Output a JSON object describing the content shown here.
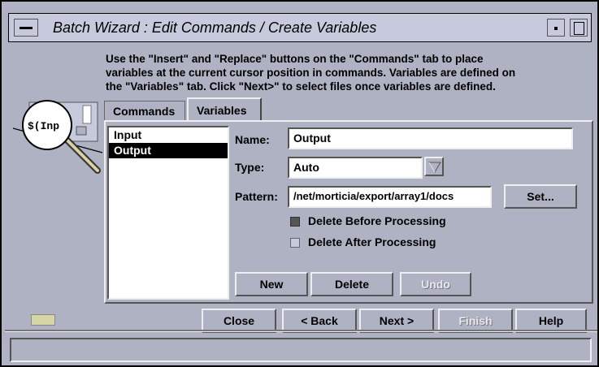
{
  "window": {
    "title": "Batch Wizard : Edit Commands / Create Variables"
  },
  "instructions": {
    "line1": "Use the \"Insert\" and \"Replace\" buttons on the \"Commands\" tab to place",
    "line2": "variables at the current cursor position in commands. Variables are defined on",
    "line3": "the \"Variables\" tab. Click \"Next>\" to select files once variables are defined."
  },
  "icon": {
    "magnifier_text": "$(Inp"
  },
  "tabs": {
    "commands": "Commands",
    "variables": "Variables",
    "active": "Variables"
  },
  "variables_list": {
    "items": [
      "Input",
      "Output"
    ],
    "selected": "Output"
  },
  "form": {
    "name_label": "Name:",
    "name_value": "Output",
    "type_label": "Type:",
    "type_value": "Auto",
    "pattern_label": "Pattern:",
    "pattern_value": "/net/morticia/export/array1/docs",
    "set_button": "Set...",
    "delete_before_label": "Delete Before Processing",
    "delete_before_checked": true,
    "delete_after_label": "Delete After Processing",
    "delete_after_checked": false
  },
  "list_buttons": {
    "new": "New",
    "delete": "Delete",
    "undo": "Undo"
  },
  "nav_buttons": {
    "close": "Close",
    "back": "< Back",
    "next": "Next >",
    "finish": "Finish",
    "help": "Help"
  },
  "colors": {
    "background": "#aeb2c3",
    "titlebar": "#c6cadc",
    "selection": "#000000",
    "indicator": "#d6d5a6"
  }
}
